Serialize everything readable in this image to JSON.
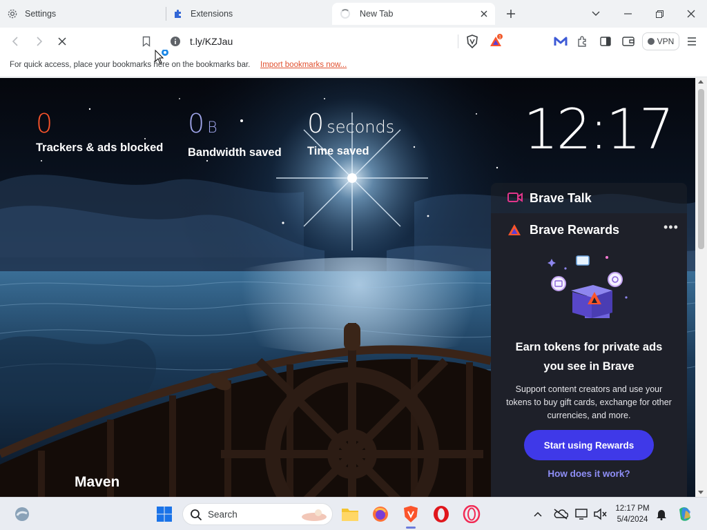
{
  "tabs": {
    "settings": "Settings",
    "extensions": "Extensions",
    "new_tab": "New Tab"
  },
  "toolbar": {
    "url": "t.ly/KZJau",
    "vpn_label": "VPN",
    "rewards_badge": "1"
  },
  "bookmarks_bar": {
    "message": "For quick access, place your bookmarks here on the bookmarks bar.",
    "import_link": "Import bookmarks now..."
  },
  "stats": {
    "trackers": {
      "value": "0",
      "label": "Trackers & ads blocked"
    },
    "bandwidth": {
      "value": "0",
      "unit": "B",
      "label": "Bandwidth saved"
    },
    "time": {
      "value": "0",
      "unit": "seconds",
      "label": "Time saved"
    }
  },
  "clock": "12:17",
  "photo_credit": "Maven",
  "widgets": {
    "talk": {
      "title": "Brave Talk"
    },
    "rewards": {
      "title": "Brave Rewards",
      "menu": "•••",
      "headline_line1": "Earn tokens for private ads",
      "headline_line2": "you see in Brave",
      "body": "Support content creators and use your tokens to buy gift cards, exchange for other currencies, and more.",
      "cta": "Start using Rewards",
      "how": "How does it work?"
    }
  },
  "taskbar": {
    "search_label": "Search",
    "time": "12:17 PM",
    "date": "5/4/2024"
  },
  "colors": {
    "trackers_accent": "#fb542b",
    "bandwidth_accent": "#a0a5eb",
    "cta_bg": "#3f39e8",
    "link": "#8f8ff7"
  }
}
